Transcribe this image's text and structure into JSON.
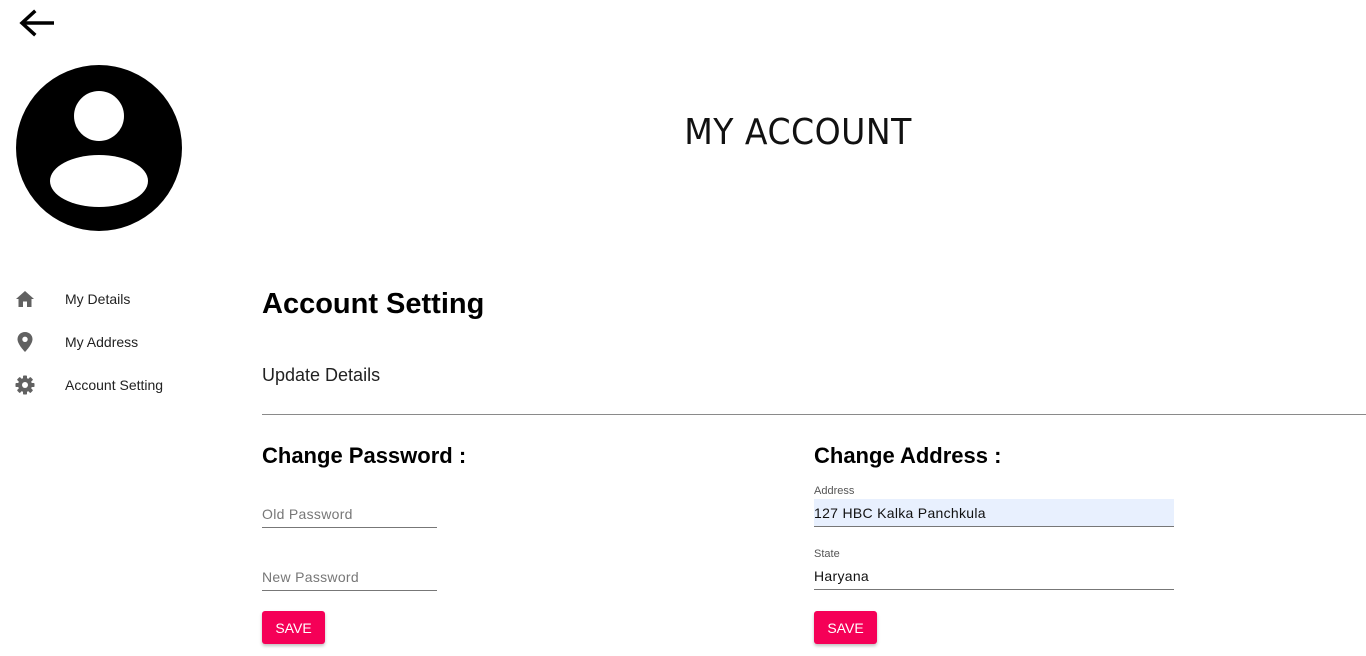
{
  "page": {
    "title": "MY ACCOUNT"
  },
  "sidebar": {
    "items": [
      {
        "label": "My Details",
        "icon": "home-icon"
      },
      {
        "label": "My Address",
        "icon": "location-pin-icon"
      },
      {
        "label": "Account Setting",
        "icon": "gear-icon"
      }
    ]
  },
  "main": {
    "section_title": "Account Setting",
    "subtitle": "Update Details",
    "password": {
      "heading": "Change Password :",
      "old_placeholder": "Old Password",
      "new_placeholder": "New Password",
      "save_label": "SAVE"
    },
    "address": {
      "heading": "Change Address :",
      "address_label": "Address",
      "address_value": "127 HBC Kalka Panchkula",
      "state_label": "State",
      "state_value": "Haryana",
      "save_label": "SAVE"
    }
  },
  "colors": {
    "accent": "#f50057",
    "autofill_bg": "#e8f0fe",
    "icon_gray": "#616161"
  }
}
